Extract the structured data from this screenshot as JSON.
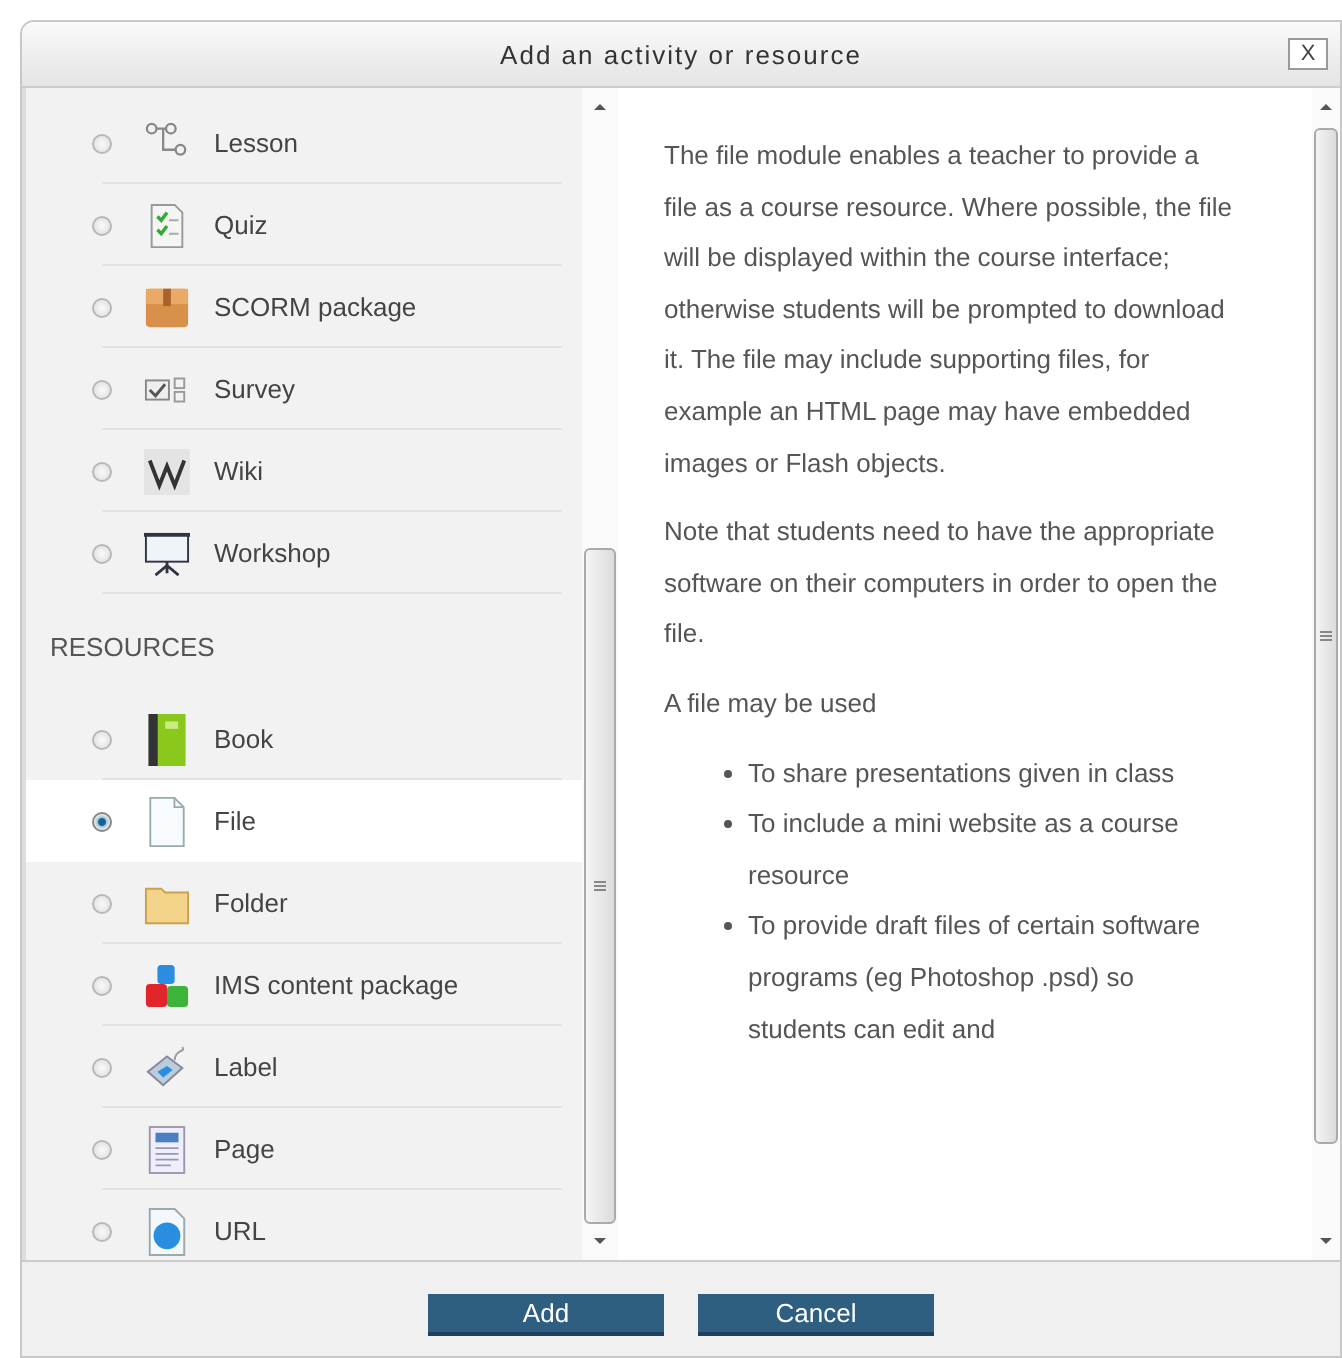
{
  "window": {
    "title": "Add an activity or resource",
    "close": "X"
  },
  "sections": [
    {
      "items": [
        {
          "label": "Lesson",
          "selected": false
        },
        {
          "label": "Quiz",
          "selected": false
        },
        {
          "label": "SCORM package",
          "selected": false
        },
        {
          "label": "Survey",
          "selected": false
        },
        {
          "label": "Wiki",
          "selected": false
        },
        {
          "label": "Workshop",
          "selected": false
        }
      ]
    },
    {
      "heading": "RESOURCES",
      "items": [
        {
          "label": "Book",
          "selected": false
        },
        {
          "label": "File",
          "selected": true
        },
        {
          "label": "Folder",
          "selected": false
        },
        {
          "label": "IMS content package",
          "selected": false
        },
        {
          "label": "Label",
          "selected": false
        },
        {
          "label": "Page",
          "selected": false
        },
        {
          "label": "URL",
          "selected": false
        }
      ]
    }
  ],
  "description": {
    "paragraphs": [
      "The file module enables a teacher to provide a file as a course resource. Where possible, the file will be displayed within the course interface; otherwise students will be prompted to download it. The file may include supporting files, for example an HTML page may have embedded images or Flash objects.",
      "Note that students need to have the appropriate software on their computers in order to open the file.",
      "A file may be used"
    ],
    "bullets": [
      "To share presentations given in class",
      "To include a mini website as a course resource",
      "To provide draft files of certain software programs (eg Photoshop .psd) so students can edit and"
    ]
  },
  "buttons": [
    "Add",
    "Cancel"
  ]
}
